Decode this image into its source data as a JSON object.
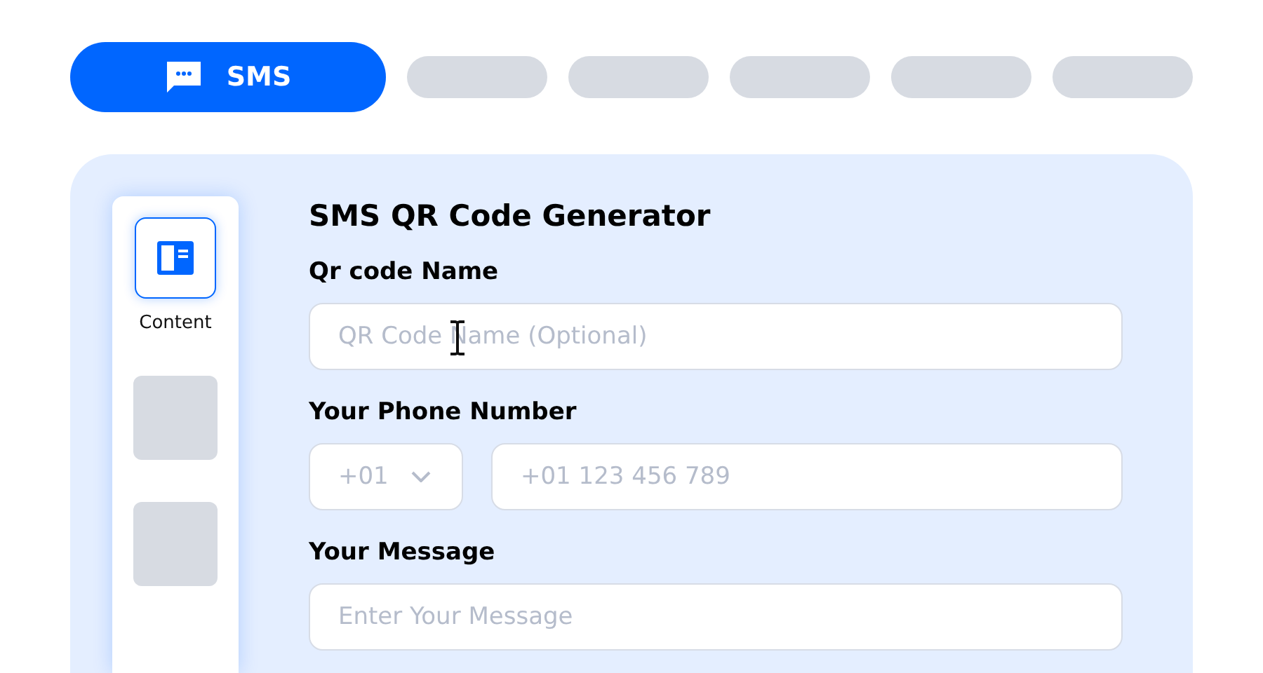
{
  "tabs": [
    {
      "kind": "labeled",
      "label": "SMS",
      "selected": true
    },
    {
      "kind": "placeholder",
      "selected": false
    },
    {
      "kind": "placeholder",
      "selected": false
    },
    {
      "kind": "placeholder",
      "selected": false
    },
    {
      "kind": "placeholder",
      "selected": false
    },
    {
      "kind": "placeholder",
      "selected": false
    }
  ],
  "sidebar": {
    "items": [
      {
        "kind": "labeled",
        "label": "Content",
        "selected": true
      },
      {
        "kind": "placeholder",
        "selected": false
      },
      {
        "kind": "placeholder",
        "selected": false
      }
    ]
  },
  "form": {
    "title": "SMS QR Code Generator",
    "fields": [
      {
        "kind": "text",
        "label": "Qr code Name",
        "placeholder": "QR Code Name (Optional)",
        "cursor": true
      },
      {
        "kind": "phone",
        "label": "Your Phone Number",
        "code": "+01",
        "placeholder": "+01 123 456 789"
      },
      {
        "kind": "text",
        "label": "Your Message",
        "placeholder": "Enter Your Message"
      }
    ]
  }
}
